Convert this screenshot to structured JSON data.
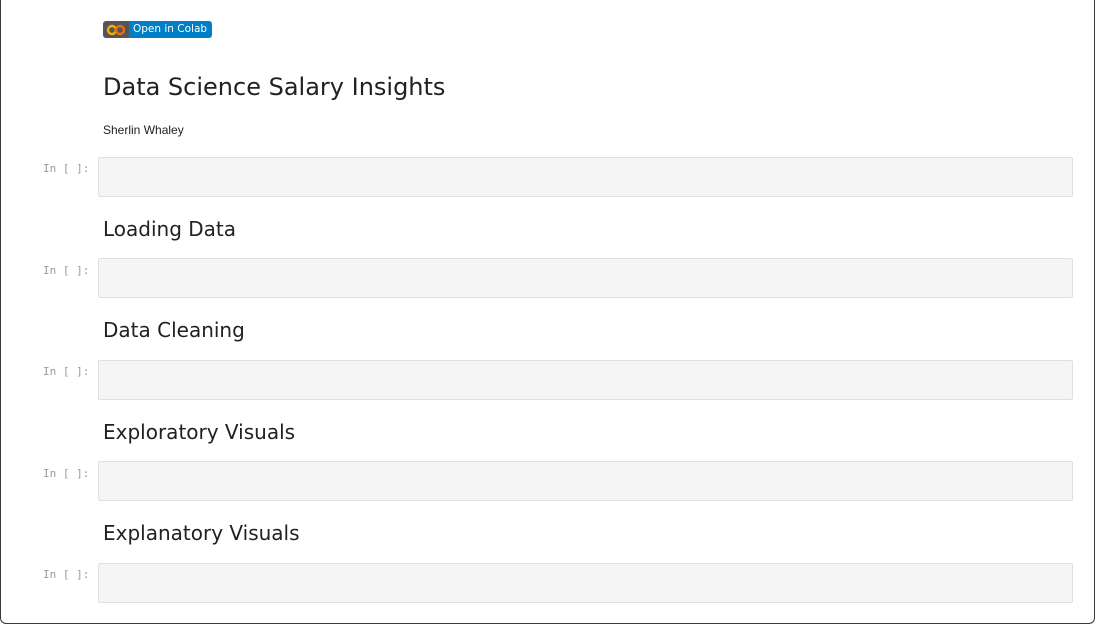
{
  "colab_badge": {
    "label": "Open in Colab",
    "icon": "colab-logo-icon",
    "colors": {
      "logo_bg": "#555555",
      "label_bg": "#007ec6",
      "logo_accent": "#f9ab00"
    }
  },
  "notebook": {
    "title": "Data Science Salary Insights",
    "author": "Sherlin Whaley",
    "prompt_label": "In [ ]:",
    "sections": [
      {
        "heading": "Loading Data"
      },
      {
        "heading": "Data Cleaning"
      },
      {
        "heading": "Exploratory Visuals"
      },
      {
        "heading": "Explanatory Visuals"
      }
    ]
  }
}
